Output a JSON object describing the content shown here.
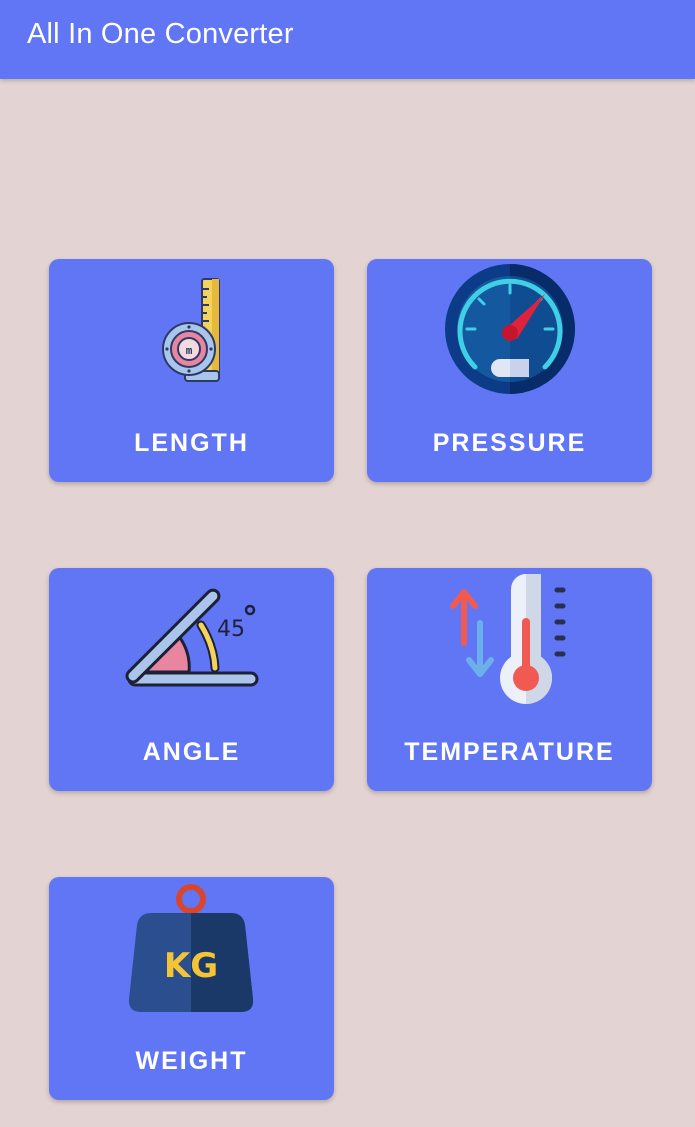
{
  "app": {
    "title": "All In One Converter"
  },
  "cards": [
    {
      "label": "LENGTH",
      "icon": "measuring-tape-icon"
    },
    {
      "label": "PRESSURE",
      "icon": "pressure-gauge-icon"
    },
    {
      "label": "ANGLE",
      "icon": "angle-icon"
    },
    {
      "label": "TEMPERATURE",
      "icon": "thermometer-icon"
    },
    {
      "label": "WEIGHT",
      "icon": "weight-icon",
      "icon_text": "KG"
    }
  ],
  "colors": {
    "primary": "#6176f5",
    "background": "#e3d3d2",
    "text_on_primary": "#ffffff"
  }
}
